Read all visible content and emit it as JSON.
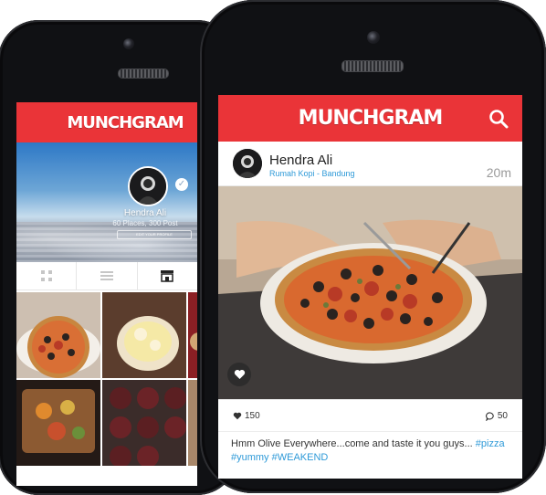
{
  "app": {
    "name": "MUNCHGRAM"
  },
  "profile": {
    "name": "Hendra Ali",
    "stats": "60 Places, 300 Post",
    "edit_label": "EDIT YOUR PROFILE"
  },
  "feed_post": {
    "author": "Hendra Ali",
    "location": "Rumah Kopi - Bandung",
    "time": "20m",
    "likes": "150",
    "comments": "50",
    "caption_text": "Hmm Olive Everywhere...come and taste it you guys... ",
    "hashtags": [
      "#pizza",
      "#yummy",
      "#WEAKEND"
    ]
  },
  "colors": {
    "brand_red": "#ea3438",
    "link_blue": "#2f9ad8"
  },
  "icons": [
    "search-icon",
    "grid-view-icon",
    "list-view-icon",
    "store-icon",
    "verified-icon",
    "heart-icon",
    "comment-icon"
  ]
}
